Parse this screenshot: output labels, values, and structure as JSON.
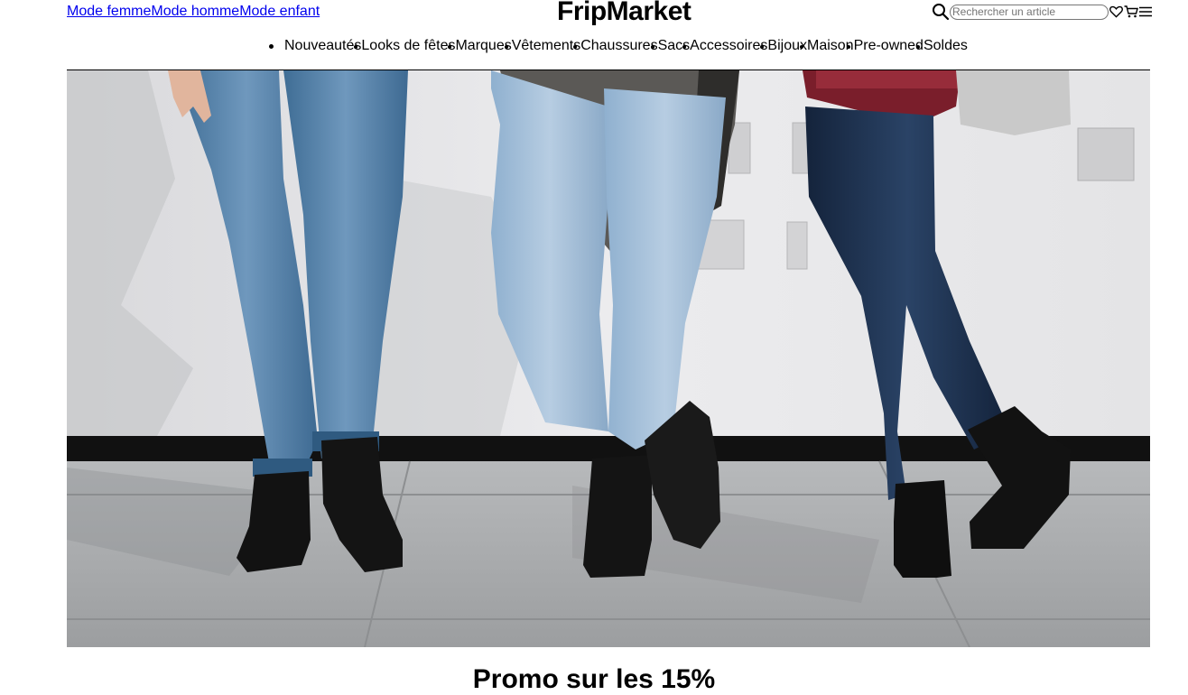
{
  "header": {
    "gender_links": [
      "Mode femme",
      "Mode homme",
      "Mode enfant"
    ],
    "logo": "FripMarket",
    "search": {
      "placeholder": "Rechercher un article",
      "value": ""
    },
    "icons": [
      "search-icon",
      "heart-icon",
      "cart-icon",
      "menu-icon"
    ]
  },
  "nav": {
    "items": [
      "Nouveautés",
      "Looks de fêtes",
      "Marques",
      "Vêtements",
      "Chaussures",
      "Sacs",
      "Accessoires",
      "Bijoux",
      "Maison",
      "Pre-owned",
      "Soldes"
    ]
  },
  "hero": {
    "image": "three-people-jeans-ankle-boots"
  },
  "promo": {
    "title": "Promo sur les 15%"
  },
  "colors": {
    "link": "#0000ee",
    "text": "#000000",
    "background": "#ffffff"
  }
}
